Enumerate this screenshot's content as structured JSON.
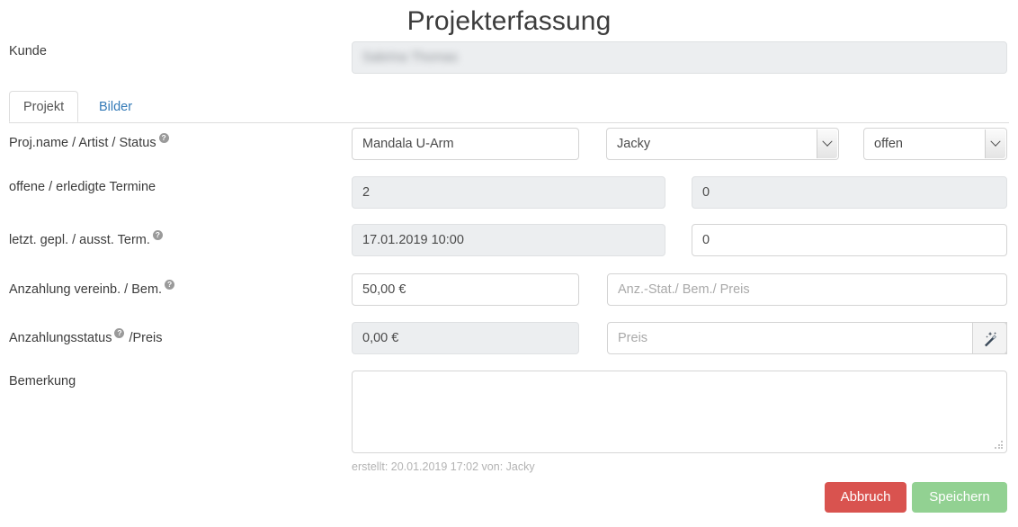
{
  "page": {
    "title": "Projekterfassung"
  },
  "customer": {
    "label": "Kunde",
    "value": "Sabrina Thomas",
    "redacted": true
  },
  "tabs": [
    {
      "label": "Projekt",
      "active": true
    },
    {
      "label": "Bilder",
      "active": false
    }
  ],
  "help_glyph": "?",
  "rows": {
    "project": {
      "label": "Proj.name / Artist / Status",
      "has_help": true,
      "name_value": "Mandala U-Arm",
      "artist_value": "Jacky",
      "status_value": "offen"
    },
    "appointments": {
      "label": "offene / erledigte Termine",
      "has_help": false,
      "open_value": "2",
      "done_value": "0"
    },
    "terms": {
      "label": "letzt. gepl. / ausst. Term.",
      "has_help": true,
      "last_planned_value": "17.01.2019 10:00",
      "outstanding_value": "0"
    },
    "deposit_agreed": {
      "label": "Anzahlung vereinb. / Bem.",
      "has_help": true,
      "amount_value": "50,00 €",
      "note_placeholder": "Anz.-Stat./ Bem./ Preis"
    },
    "deposit_status": {
      "label_before": "Anzahlungsstatus",
      "label_after": "/Preis",
      "has_help": true,
      "status_value": "0,00 €",
      "price_placeholder": "Preis",
      "wand_icon": "magic-wand-icon"
    },
    "remark": {
      "label": "Bemerkung",
      "value": "",
      "placeholder": ""
    }
  },
  "meta": {
    "created_text": "erstellt: 20.01.2019 17:02 von: Jacky"
  },
  "actions": {
    "cancel_label": "Abbruch",
    "save_label": "Speichern"
  },
  "colors": {
    "cancel_bg": "#d9534f",
    "save_bg": "#92d192",
    "tab_link": "#337ab7",
    "disabled_bg": "#eceef0",
    "border": "#d4d4d4",
    "placeholder": "#a9a9a9"
  }
}
